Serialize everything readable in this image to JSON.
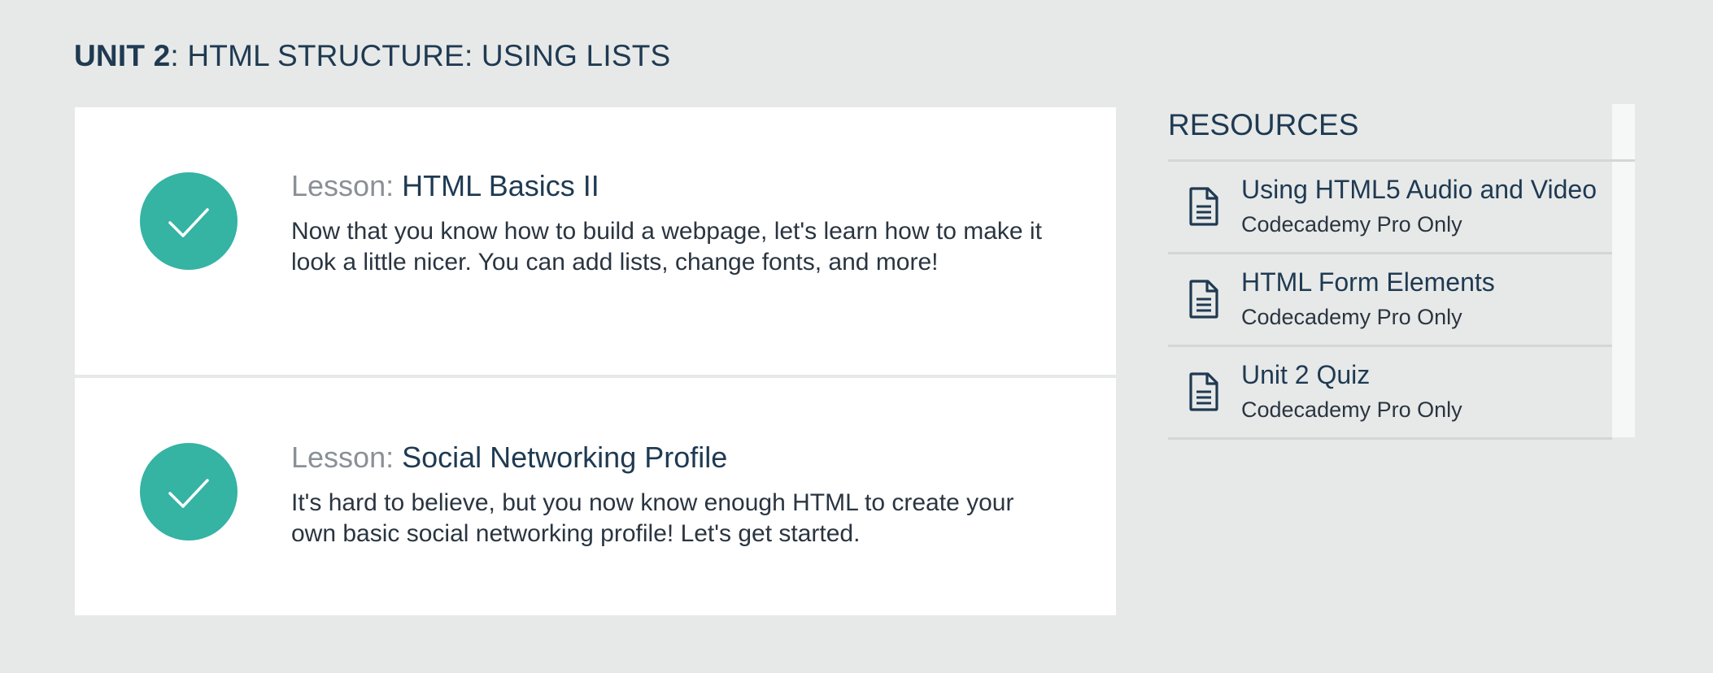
{
  "unit": {
    "label": "UNIT 2",
    "title": ": HTML STRUCTURE: USING LISTS"
  },
  "lessons": [
    {
      "prefix": "Lesson: ",
      "name": "HTML Basics II",
      "description": "Now that you know how to build a webpage, let's learn how to make it look a little nicer. You can add lists, change fonts, and more!",
      "status": "completed",
      "icon": "check-icon"
    },
    {
      "prefix": "Lesson: ",
      "name": "Social Networking Profile",
      "description": "It's hard to believe, but you now know enough HTML to create your own basic social networking profile! Let's get started.",
      "status": "completed",
      "icon": "check-icon"
    }
  ],
  "resources": {
    "title": "RESOURCES",
    "items": [
      {
        "name": "Using HTML5 Audio and Video",
        "note": "Codecademy Pro Only",
        "icon": "document-icon"
      },
      {
        "name": "HTML Form Elements",
        "note": "Codecademy Pro Only",
        "icon": "document-icon"
      },
      {
        "name": "Unit 2 Quiz",
        "note": "Codecademy Pro Only",
        "icon": "document-icon"
      }
    ]
  },
  "colors": {
    "background": "#e7e9e8",
    "accent": "#35b3a3",
    "text_dark": "#1f3a52",
    "text_muted": "#8a9096"
  }
}
